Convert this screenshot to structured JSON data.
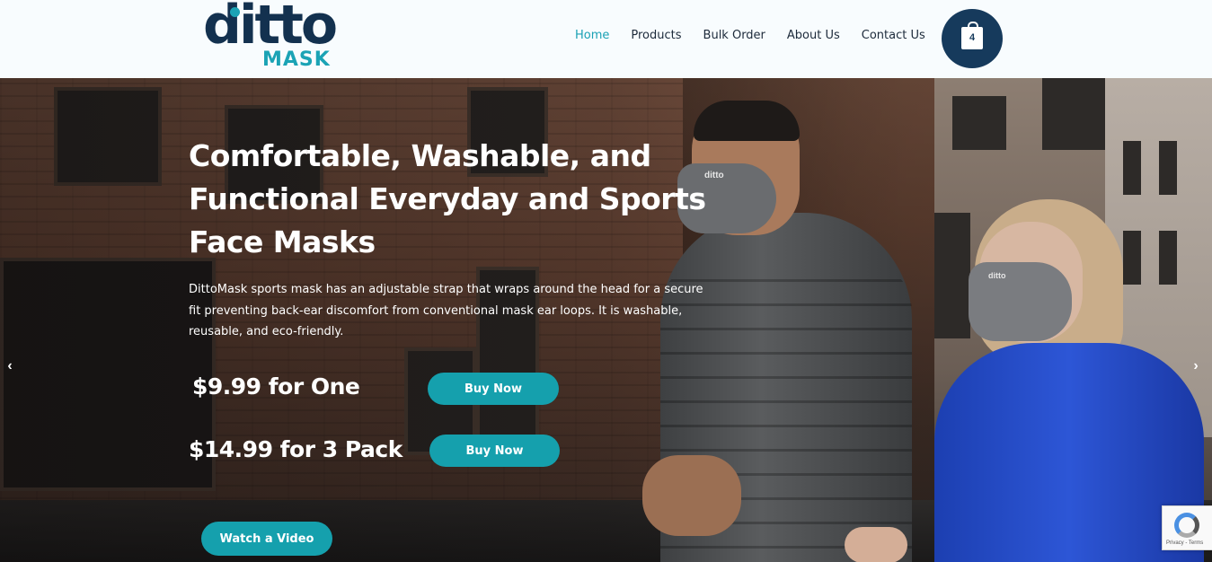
{
  "brand": {
    "logo_word": "ditto",
    "logo_sub": "MASK"
  },
  "nav": {
    "items": [
      {
        "label": "Home",
        "active": true
      },
      {
        "label": "Products",
        "active": false
      },
      {
        "label": "Bulk Order",
        "active": false
      },
      {
        "label": "About Us",
        "active": false
      },
      {
        "label": "Contact Us",
        "active": false
      }
    ]
  },
  "cart": {
    "count": "4",
    "icon": "shopping-bag-icon"
  },
  "hero": {
    "title": "Comfortable, Washable, and Functional Everyday and Sports Face Masks",
    "description": "DittoMask sports mask has an adjustable strap that wraps around the head for a secure fit preventing back-ear discomfort from conventional mask ear loops. It is washable, reusable, and eco-friendly.",
    "offers": [
      {
        "price": "$9.99 for One",
        "button": "Buy Now"
      },
      {
        "price": "$14.99 for 3 Pack",
        "button": "Buy Now"
      }
    ],
    "video_button": "Watch a Video",
    "mask_label": "ditto",
    "prev_arrow": "‹",
    "next_arrow": "›"
  },
  "recaptcha": {
    "text": "Privacy - Terms"
  },
  "colors": {
    "accent": "#15a0ad",
    "brand_dark": "#13314f",
    "nav_active": "#1aa1b4",
    "cart_bg": "#163a5c"
  }
}
